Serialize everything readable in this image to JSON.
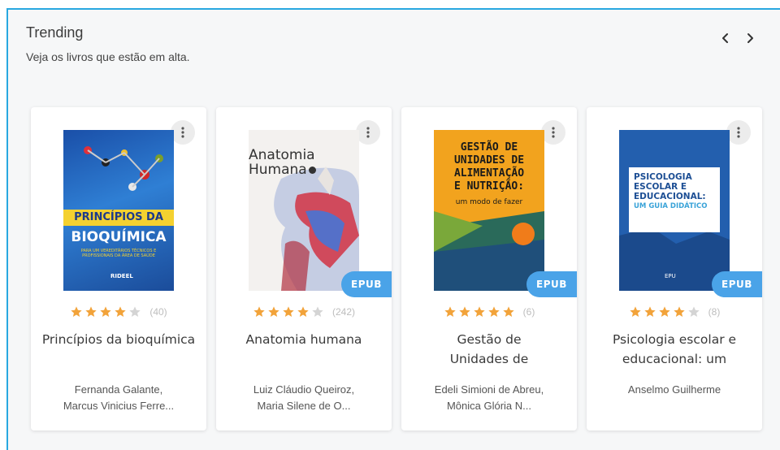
{
  "header": {
    "title": "Trending",
    "subtitle": "Veja os livros que estão em alta."
  },
  "nav": {
    "prev_icon": "chevron-left-icon",
    "next_icon": "chevron-right-icon"
  },
  "badge_label": "EPUB",
  "colors": {
    "accent": "#4aa3e8",
    "star": "#f2a33a",
    "star_empty": "#d4d4d4",
    "border": "#29a8e0"
  },
  "books": [
    {
      "title": "Princípios da bioquímica",
      "authors": [
        "Fernanda Galante,",
        "Marcus Vinicius Ferre..."
      ],
      "rating": 4,
      "count": "(40)",
      "epub": false,
      "cover": {
        "line1": "PRINCÍPIOS DA",
        "line2": "BIOQUÍMICA",
        "line3": "PARA UM VEREDITÁRIOS TÉCNICOS E PROFISSIONAIS DA ÁREA DE SAÚDE",
        "publisher": "RIDEEL"
      }
    },
    {
      "title": "Anatomia humana",
      "authors": [
        "Luiz Cláudio Queiroz,",
        "Maria Silene de O..."
      ],
      "rating": 4,
      "count": "(242)",
      "epub": true,
      "cover": {
        "line1": "Anatomia",
        "line2": "Humana"
      }
    },
    {
      "title": "Gestão de Unidades de",
      "authors": [
        "Edeli Simioni de Abreu,",
        "Mônica Glória N..."
      ],
      "rating": 5,
      "count": "(6)",
      "epub": true,
      "cover": {
        "line1": "GESTÃO DE",
        "line2": "UNIDADES DE",
        "line3": "ALIMENTAÇÃO",
        "line4": "E NUTRIÇÃO:",
        "line5": "um modo de fazer"
      }
    },
    {
      "title": "Psicologia escolar e educacional: um",
      "authors": [
        "Anselmo Guilherme"
      ],
      "rating": 4,
      "count": "(8)",
      "epub": true,
      "cover": {
        "line1": "PSICOLOGIA",
        "line2": "ESCOLAR E",
        "line3": "EDUCACIONAL:",
        "line4": "UM GUIA DIDÁTICO",
        "publisher": "EPU"
      }
    }
  ]
}
